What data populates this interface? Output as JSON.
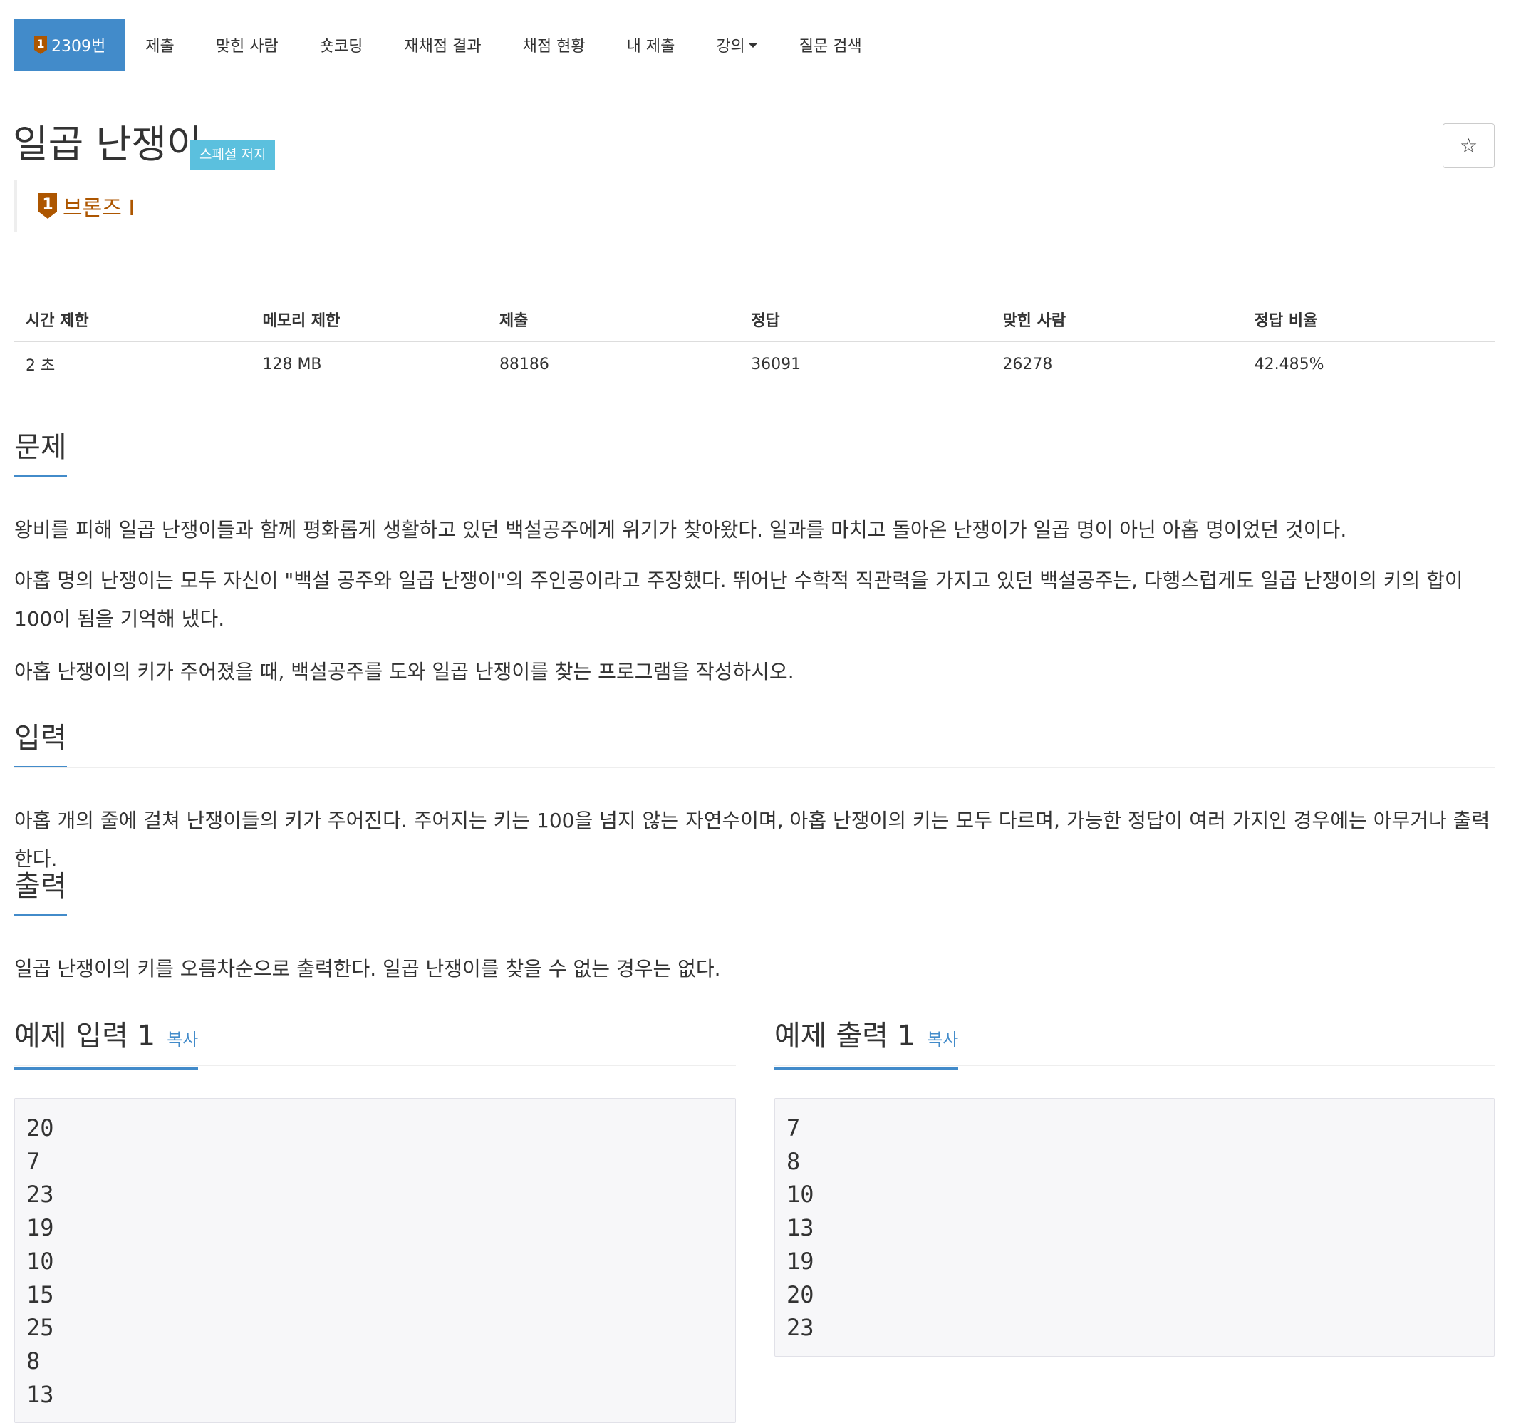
{
  "nav": {
    "problem_no": "2309번",
    "tier_digit": "1",
    "items": [
      "제출",
      "맞힌 사람",
      "숏코딩",
      "재채점 결과",
      "채점 현황",
      "내 제출",
      "강의",
      "질문 검색"
    ]
  },
  "header": {
    "title": "일곱 난쟁이",
    "label": "스페셜 저지",
    "star": "☆",
    "tier_digit": "1",
    "tier_name": "브론즈 I"
  },
  "info": {
    "headers": [
      "시간 제한",
      "메모리 제한",
      "제출",
      "정답",
      "맞힌 사람",
      "정답 비율"
    ],
    "values": [
      "2 초",
      "128 MB",
      "88186",
      "36091",
      "26278",
      "42.485%"
    ]
  },
  "problem": {
    "heading": "문제",
    "paragraphs": [
      "왕비를 피해 일곱 난쟁이들과 함께 평화롭게 생활하고 있던 백설공주에게 위기가 찾아왔다. 일과를 마치고 돌아온 난쟁이가 일곱 명이 아닌 아홉 명이었던 것이다.",
      "아홉 명의 난쟁이는 모두 자신이 \"백설 공주와 일곱 난쟁이\"의 주인공이라고 주장했다. 뛰어난 수학적 직관력을 가지고 있던 백설공주는, 다행스럽게도 일곱 난쟁이의 키의 합이 100이 됨을 기억해 냈다.",
      "아홉 난쟁이의 키가 주어졌을 때, 백설공주를 도와 일곱 난쟁이를 찾는 프로그램을 작성하시오."
    ]
  },
  "input": {
    "heading": "입력",
    "text": "아홉 개의 줄에 걸쳐 난쟁이들의 키가 주어진다. 주어지는 키는 100을 넘지 않는 자연수이며, 아홉 난쟁이의 키는 모두 다르며, 가능한 정답이 여러 가지인 경우에는 아무거나 출력한다."
  },
  "output": {
    "heading": "출력",
    "text": "일곱 난쟁이의 키를 오름차순으로 출력한다. 일곱 난쟁이를 찾을 수 없는 경우는 없다."
  },
  "sample_input": {
    "heading": "예제 입력 1",
    "copy": "복사",
    "lines": [
      "20",
      "7",
      "23",
      "19",
      "10",
      "15",
      "25",
      "8",
      "13"
    ]
  },
  "sample_output": {
    "heading": "예제 출력 1",
    "copy": "복사",
    "lines": [
      "7",
      "8",
      "10",
      "13",
      "19",
      "20",
      "23"
    ]
  },
  "colors": {
    "primary": "#428bca",
    "label": "#5bc0de",
    "bronze": "#ad5600"
  }
}
